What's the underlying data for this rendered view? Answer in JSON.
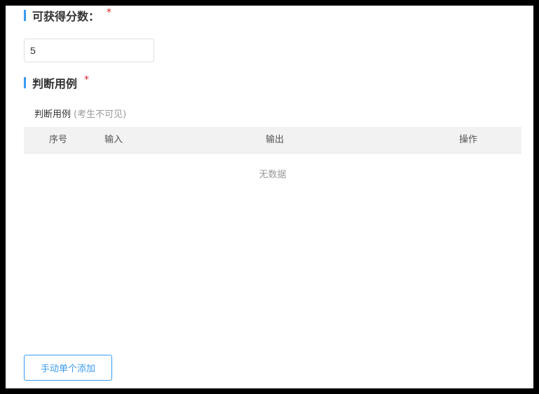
{
  "score_section": {
    "title": "可获得分数：",
    "required_mark": "*",
    "value": "5"
  },
  "cases_section": {
    "title": "判断用例",
    "required_mark": "*",
    "caption": "判断用例",
    "caption_hint": "(考生不可见)",
    "columns": {
      "index": "序号",
      "input": "输入",
      "output": "输出",
      "action": "操作"
    },
    "empty_text": "无数据"
  },
  "add_button_label": "手动单个添加",
  "colors": {
    "accent": "#3a9bf0",
    "required": "#e0282e",
    "header_bg": "#f2f2f2"
  }
}
